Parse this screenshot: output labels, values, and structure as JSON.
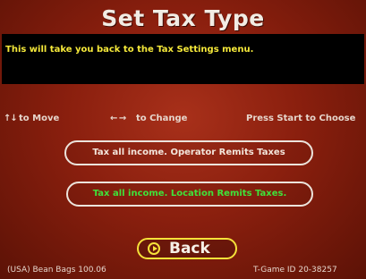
{
  "screen": {
    "title": "Set Tax Type"
  },
  "info": {
    "message": "This will take you back to the Tax Settings menu."
  },
  "hints": {
    "move_arrows": "↑↓",
    "move_label": "to Move",
    "change_arrows": "← →",
    "change_label": "to Change",
    "press_start": "Press Start to Choose"
  },
  "options": [
    {
      "label": "Tax all income. Operator Remits Taxes",
      "color": "#f3e6dc",
      "selected": false
    },
    {
      "label": "Tax all income. Location Remits Taxes.",
      "color": "#3fe23a",
      "selected": true
    }
  ],
  "back_button": {
    "label": "Back",
    "icon": "play-arrow-icon"
  },
  "footer": {
    "left": "(USA) Bean Bags 100.06",
    "right": "T-Game ID 20-38257"
  },
  "colors": {
    "title": "#f2ece4",
    "info_text": "#f4e83a",
    "selected_option": "#3fe23a",
    "back_border": "#f6e23a"
  }
}
